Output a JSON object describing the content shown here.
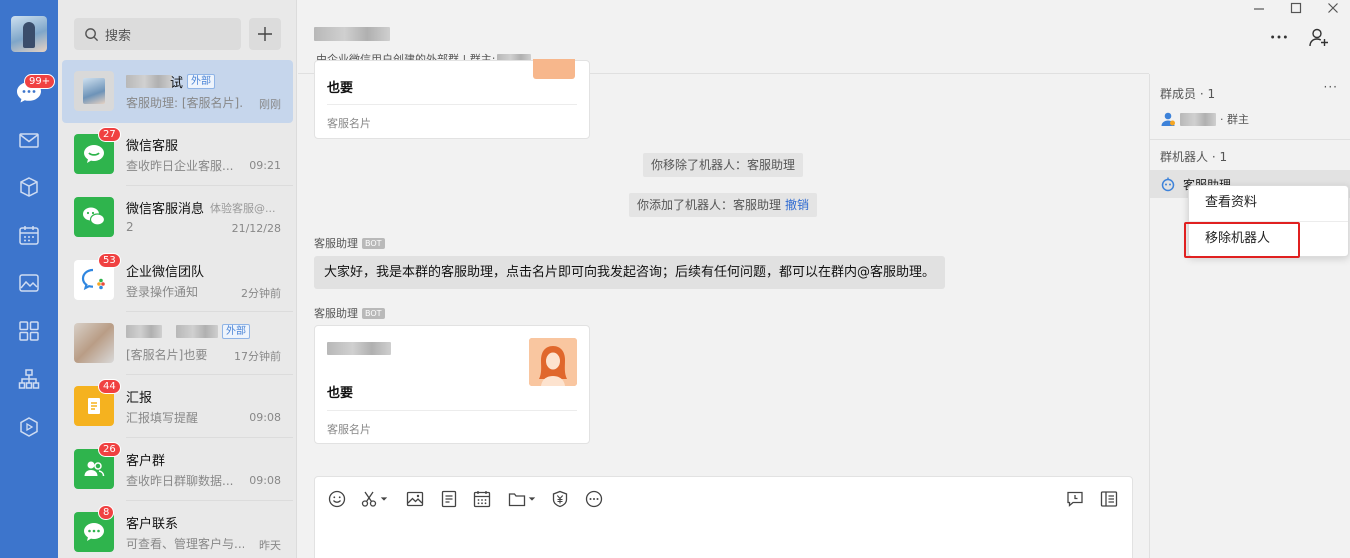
{
  "rail": {
    "messages_badge": "99+"
  },
  "list": {
    "search_placeholder": "搜索",
    "conversations": [
      {
        "name_suffix": "试",
        "tag": "外部",
        "sub": "客服助理: [客服名片]...",
        "time": "刚刚"
      },
      {
        "name": "微信客服",
        "badge": "27",
        "sub": "查收昨日企业客服...",
        "time": "09:21"
      },
      {
        "name": "微信客服消息",
        "extra": "体验客服@...",
        "sub": "2",
        "time": "21/12/28"
      },
      {
        "name": "企业微信团队",
        "badge": "53",
        "sub": "登录操作通知",
        "time": "2分钟前"
      },
      {
        "tag": "外部",
        "sub": "[客服名片]也要",
        "time": "17分钟前"
      },
      {
        "name": "汇报",
        "badge": "44",
        "sub": "汇报填写提醒",
        "time": "09:08"
      },
      {
        "name": "客户群",
        "badge": "26",
        "sub": "查收昨日群聊数据...",
        "time": "09:08"
      },
      {
        "name": "客户联系",
        "badge": "8",
        "sub": "可查看、管理客户与...",
        "time": "昨天"
      }
    ]
  },
  "chat": {
    "desc": "由企业微信用户创建的外部群 | 群主:",
    "card1": {
      "title": "也要",
      "foot": "客服名片"
    },
    "sys_removed": "你移除了机器人：客服助理",
    "sys_added": "你添加了机器人：客服助理",
    "sys_undo": "撤销",
    "sender1": "客服助理",
    "bot_tag": "BOT",
    "message": "大家好，我是本群的客服助理，点击名片即可向我发起咨询；后续有任何问题，都可以在群内@客服助理。",
    "sender2": "客服助理",
    "card2": {
      "title": "也要",
      "foot": "客服名片"
    }
  },
  "panel": {
    "members_title": "群成员 · 1",
    "owner_label": "· 群主",
    "robots_title": "群机器人 · 1",
    "robot_name": "客服助理",
    "more": "···"
  },
  "context_menu": {
    "view_profile": "查看资料",
    "remove_robot": "移除机器人"
  },
  "colors": {
    "rail_blue": "#3d75cc",
    "badge_red": "#f04141",
    "wechat_green": "#2fb44d",
    "highlight_red": "#e02020",
    "link_blue": "#2f6bd2"
  }
}
